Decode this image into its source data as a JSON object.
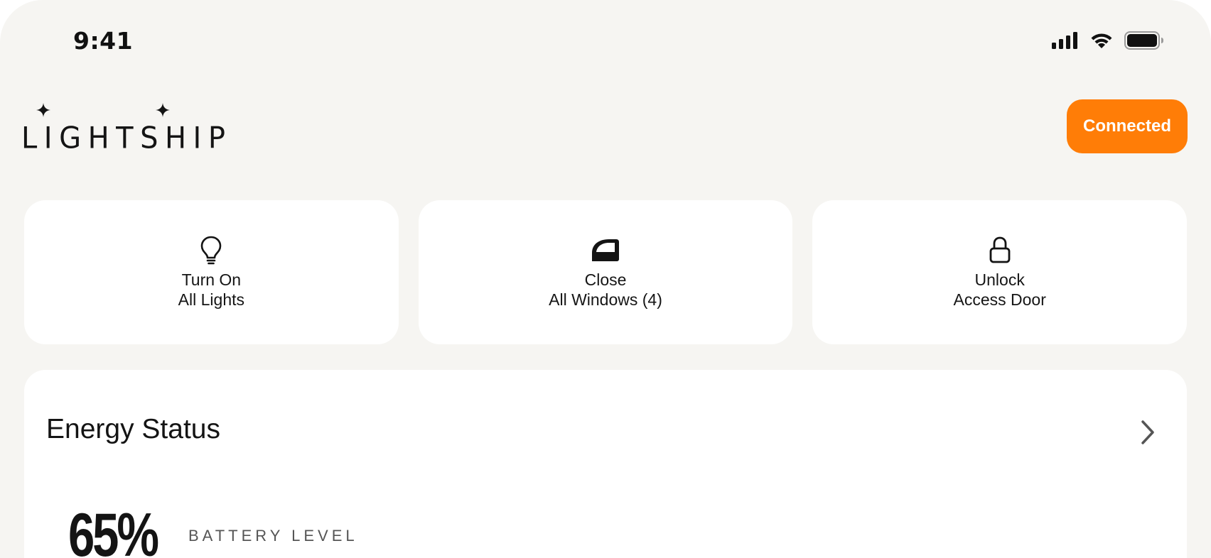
{
  "status_bar": {
    "time": "9:41",
    "icons": [
      "cellular-signal-icon",
      "wifi-icon",
      "battery-icon"
    ]
  },
  "header": {
    "logo_text": "LIGHTSHIP",
    "connection_status": "Connected"
  },
  "quick_actions": [
    {
      "icon": "lightbulb-icon",
      "line1": "Turn On",
      "line2": "All Lights"
    },
    {
      "icon": "window-icon",
      "line1": "Close",
      "line2": "All Windows (4)"
    },
    {
      "icon": "lock-icon",
      "line1": "Unlock",
      "line2": "Access Door"
    }
  ],
  "energy": {
    "title": "Energy Status",
    "battery_value": "65%",
    "battery_label": "BATTERY LEVEL"
  },
  "colors": {
    "background": "#f6f5f2",
    "card": "#ffffff",
    "accent": "#ff7d07",
    "text": "#141414"
  }
}
